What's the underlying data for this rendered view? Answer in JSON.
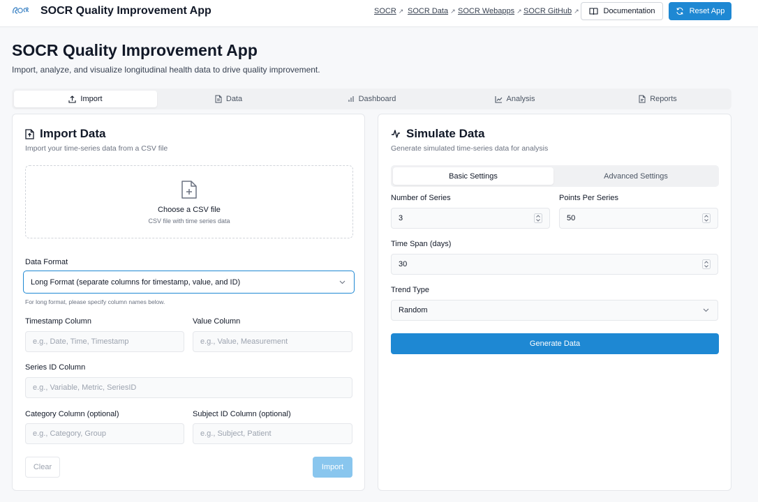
{
  "colors": {
    "accent": "#1e88d3",
    "accent_disabled": "#89c6ee"
  },
  "header": {
    "app_name": "SOCR Quality Improvement App",
    "links": [
      {
        "label": "SOCR",
        "icon": "external-link-icon"
      },
      {
        "label": "SOCR Data",
        "icon": "external-link-icon"
      },
      {
        "label": "SOCR Webapps",
        "icon": "external-link-icon"
      },
      {
        "label": "SOCR GitHub",
        "icon": "external-link-icon"
      }
    ],
    "documentation_label": "Documentation",
    "reset_label": "Reset App"
  },
  "page": {
    "title": "SOCR Quality Improvement App",
    "subtitle": "Import, analyze, and visualize longitudinal health data to drive quality improvement."
  },
  "tabs": [
    {
      "label": "Import",
      "icon": "upload-icon",
      "active": true
    },
    {
      "label": "Data",
      "icon": "file-icon",
      "active": false
    },
    {
      "label": "Dashboard",
      "icon": "bar-chart-icon",
      "active": false
    },
    {
      "label": "Analysis",
      "icon": "line-chart-icon",
      "active": false
    },
    {
      "label": "Reports",
      "icon": "report-icon",
      "active": false
    }
  ],
  "import_card": {
    "title": "Import Data",
    "description": "Import your time-series data from a CSV file",
    "dropzone": {
      "title": "Choose a CSV file",
      "subtitle": "CSV file with time series data"
    },
    "data_format": {
      "label": "Data Format",
      "value": "Long Format (separate columns for timestamp, value, and ID)",
      "hint": "For long format, please specify column names below."
    },
    "timestamp": {
      "label": "Timestamp Column",
      "placeholder": "e.g., Date, Time, Timestamp"
    },
    "value": {
      "label": "Value Column",
      "placeholder": "e.g., Value, Measurement"
    },
    "series_id": {
      "label": "Series ID Column",
      "placeholder": "e.g., Variable, Metric, SeriesID"
    },
    "category": {
      "label": "Category Column (optional)",
      "placeholder": "e.g., Category, Group"
    },
    "subject": {
      "label": "Subject ID Column (optional)",
      "placeholder": "e.g., Subject, Patient"
    },
    "clear_label": "Clear",
    "import_label": "Import"
  },
  "simulate_card": {
    "title": "Simulate Data",
    "description": "Generate simulated time-series data for analysis",
    "subtabs": [
      {
        "label": "Basic Settings",
        "active": true
      },
      {
        "label": "Advanced Settings",
        "active": false
      }
    ],
    "num_series": {
      "label": "Number of Series",
      "value": "3"
    },
    "points_per_series": {
      "label": "Points Per Series",
      "value": "50"
    },
    "time_span": {
      "label": "Time Span (days)",
      "value": "30"
    },
    "trend_type": {
      "label": "Trend Type",
      "value": "Random"
    },
    "generate_label": "Generate Data"
  }
}
